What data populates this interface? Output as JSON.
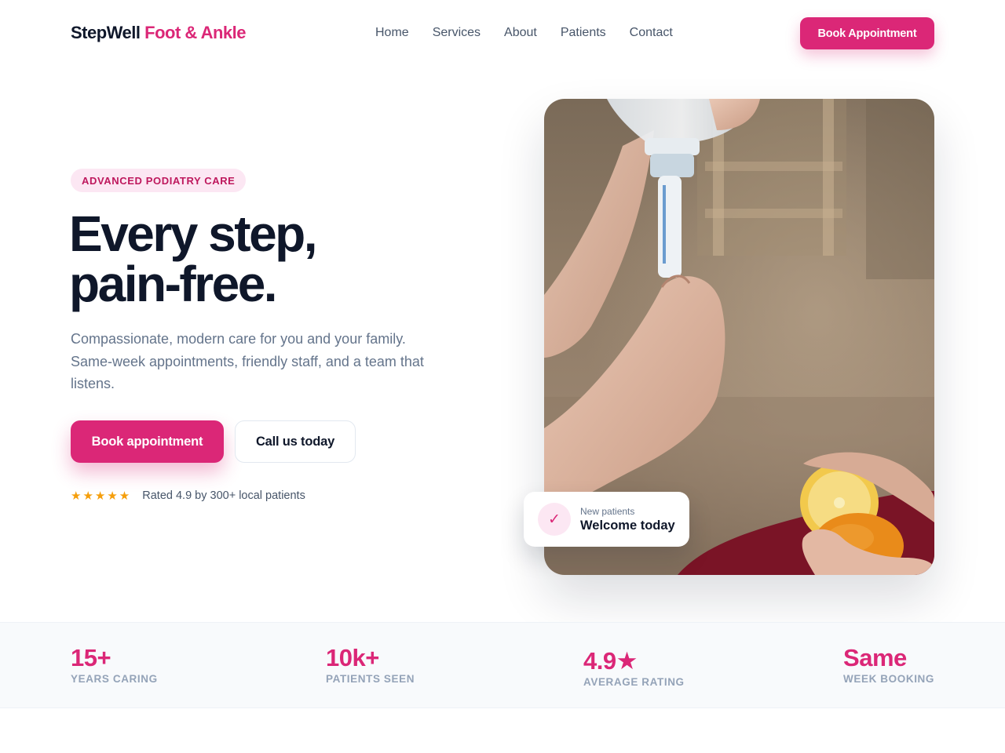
{
  "colors": {
    "accent": "#db2777",
    "accent_soft": "#fce7f3",
    "heading": "#0f172a",
    "body_text": "#64748b",
    "star": "#f59e0b",
    "stats_bg": "#f8fafc"
  },
  "header": {
    "brand_primary": "StepWell",
    "brand_accent": "Foot & Ankle",
    "nav": [
      {
        "label": "Home"
      },
      {
        "label": "Services"
      },
      {
        "label": "About"
      },
      {
        "label": "Patients"
      },
      {
        "label": "Contact"
      }
    ],
    "cta_label": "Book Appointment"
  },
  "hero": {
    "eyebrow": "ADVANCED PODIATRY CARE",
    "headline_line1": "Every step,",
    "headline_line2": "pain-free.",
    "subtext": "Compassionate, modern care for you and your family. Same-week appointments, friendly staff, and a team that listens.",
    "primary_button": "Book appointment",
    "secondary_button": "Call us today",
    "rating_stars": "★★★★★",
    "rating_value": 4.9,
    "rating_text": "Rated 4.9 by 300+ local patients"
  },
  "photo_card": {
    "icon": "check-icon",
    "check_glyph": "✓",
    "small_text": "New patients",
    "big_text": "Welcome today"
  },
  "stats": [
    {
      "value": "15+",
      "label": "YEARS CARING"
    },
    {
      "value": "10k+",
      "label": "PATIENTS SEEN"
    },
    {
      "value": "4.9★",
      "label": "AVERAGE RATING"
    },
    {
      "value": "Same",
      "label": "WEEK BOOKING"
    }
  ]
}
